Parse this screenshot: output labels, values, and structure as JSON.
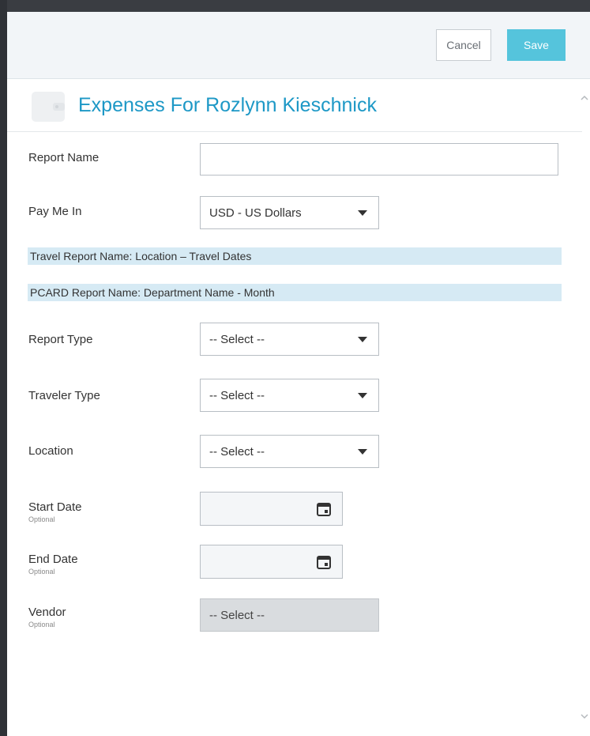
{
  "header": {
    "cancel_label": "Cancel",
    "save_label": "Save"
  },
  "page": {
    "title": "Expenses For Rozlynn Kieschnick"
  },
  "form": {
    "report_name": {
      "label": "Report Name",
      "value": ""
    },
    "pay_me_in": {
      "label": "Pay Me In",
      "value": "USD - US Dollars"
    },
    "banners": [
      "Travel Report Name: Location – Travel Dates",
      "PCARD Report Name: Department Name - Month"
    ],
    "report_type": {
      "label": "Report Type",
      "value": "-- Select --"
    },
    "traveler_type": {
      "label": "Traveler Type",
      "value": "-- Select --"
    },
    "location": {
      "label": "Location",
      "value": "-- Select --"
    },
    "start_date": {
      "label": "Start Date",
      "sublabel": "Optional",
      "value": ""
    },
    "end_date": {
      "label": "End Date",
      "sublabel": "Optional",
      "value": ""
    },
    "vendor": {
      "label": "Vendor",
      "sublabel": "Optional",
      "value": "-- Select --"
    }
  },
  "icons": {
    "wallet": "wallet-icon",
    "calendar": "calendar-icon",
    "caret": "caret-down-icon"
  },
  "colors": {
    "accent": "#1d98c6",
    "save_button": "#55c4dc",
    "banner": "#d6eaf4",
    "disabled_field": "#d9dcdf"
  }
}
